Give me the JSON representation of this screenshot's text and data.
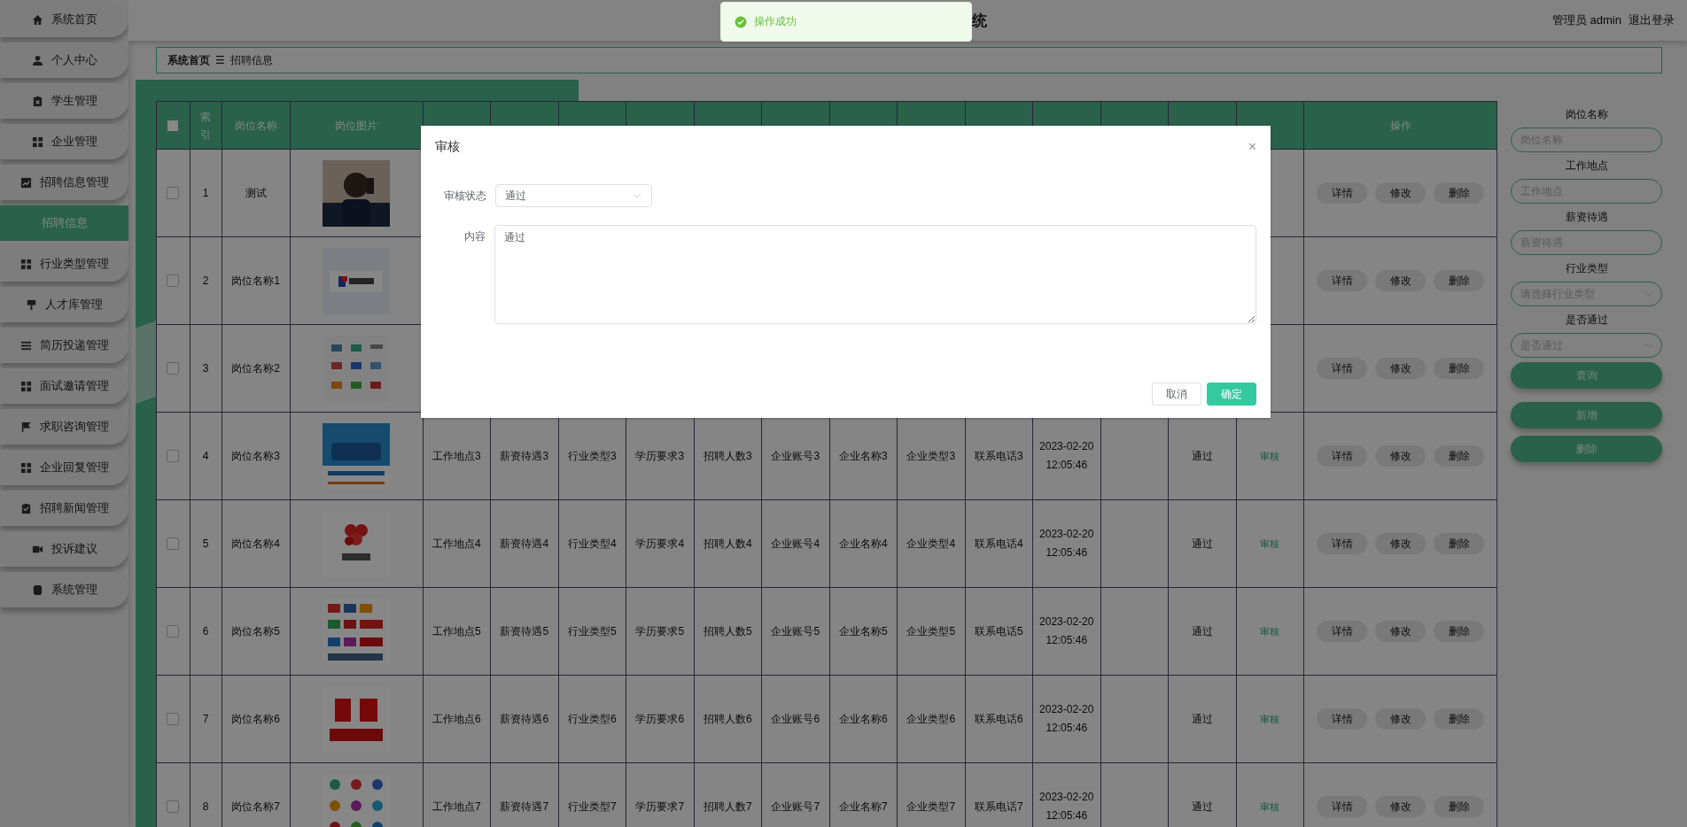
{
  "sidebar": {
    "items": [
      {
        "label": "系统首页",
        "selected": false
      },
      {
        "label": "个人中心",
        "selected": false
      },
      {
        "label": "学生管理",
        "selected": false
      },
      {
        "label": "企业管理",
        "selected": false
      },
      {
        "label": "招聘信息管理",
        "selected": false,
        "children": [
          {
            "label": "招聘信息",
            "selected": true
          }
        ]
      },
      {
        "label": "行业类型管理",
        "selected": false
      },
      {
        "label": "人才库管理",
        "selected": false
      },
      {
        "label": "简历投递管理",
        "selected": false
      },
      {
        "label": "面试邀请管理",
        "selected": false
      },
      {
        "label": "求职咨询管理",
        "selected": false
      },
      {
        "label": "企业回复管理",
        "selected": false
      },
      {
        "label": "招聘新闻管理",
        "selected": false
      },
      {
        "label": "投诉建议",
        "selected": false
      },
      {
        "label": "系统管理",
        "selected": false
      }
    ]
  },
  "header": {
    "title": "统",
    "user": "管理员 admin",
    "logout": "退出登录"
  },
  "breadcrumb": {
    "home": "系统首页",
    "separator": "☰",
    "current": "招聘信息"
  },
  "table": {
    "select_all": {
      "checked": false
    },
    "columns": {
      "index": "索引",
      "name": "岗位名称",
      "image": "岗位图片",
      "actions": "操作"
    },
    "rows": [
      {
        "checked": false,
        "index": "1",
        "name": "测试",
        "actions": [
          "详情",
          "修改",
          "删除"
        ]
      },
      {
        "checked": false,
        "index": "2",
        "name": "岗位名称1",
        "actions": [
          "详情",
          "修改",
          "删除"
        ]
      },
      {
        "checked": false,
        "index": "3",
        "name": "岗位名称2",
        "actions": [
          "详情",
          "修改",
          "删除"
        ]
      },
      {
        "checked": false,
        "index": "4",
        "name": "岗位名称3",
        "location": "工作地点3",
        "salary": "薪资待遇3",
        "industry": "行业类型3",
        "education": "学历要求3",
        "headcount": "招聘人数3",
        "account": "企业账号3",
        "company": "企业名称3",
        "company_type": "企业类型3",
        "phone": "联系电话3",
        "published": "2023-02-20 12:05:46",
        "status": "通过",
        "audit_link": "审核",
        "actions": [
          "详情",
          "修改",
          "删除"
        ]
      },
      {
        "checked": false,
        "index": "5",
        "name": "岗位名称4",
        "location": "工作地点4",
        "salary": "薪资待遇4",
        "industry": "行业类型4",
        "education": "学历要求4",
        "headcount": "招聘人数4",
        "account": "企业账号4",
        "company": "企业名称4",
        "company_type": "企业类型4",
        "phone": "联系电话4",
        "published": "2023-02-20 12:05:46",
        "status": "通过",
        "audit_link": "审核",
        "actions": [
          "详情",
          "修改",
          "删除"
        ]
      },
      {
        "checked": false,
        "index": "6",
        "name": "岗位名称5",
        "location": "工作地点5",
        "salary": "薪资待遇5",
        "industry": "行业类型5",
        "education": "学历要求5",
        "headcount": "招聘人数5",
        "account": "企业账号5",
        "company": "企业名称5",
        "company_type": "企业类型5",
        "phone": "联系电话5",
        "published": "2023-02-20 12:05:46",
        "status": "通过",
        "audit_link": "审核",
        "actions": [
          "详情",
          "修改",
          "删除"
        ]
      },
      {
        "checked": false,
        "index": "7",
        "name": "岗位名称6",
        "location": "工作地点6",
        "salary": "薪资待遇6",
        "industry": "行业类型6",
        "education": "学历要求6",
        "headcount": "招聘人数6",
        "account": "企业账号6",
        "company": "企业名称6",
        "company_type": "企业类型6",
        "phone": "联系电话6",
        "published": "2023-02-20 12:05:46",
        "status": "通过",
        "audit_link": "审核",
        "actions": [
          "详情",
          "修改",
          "删除"
        ]
      },
      {
        "checked": false,
        "index": "8",
        "name": "岗位名称7",
        "location": "工作地点7",
        "salary": "薪资待遇7",
        "industry": "行业类型7",
        "education": "学历要求7",
        "headcount": "招聘人数7",
        "account": "企业账号7",
        "company": "企业名称7",
        "company_type": "企业类型7",
        "phone": "联系电话7",
        "published": "2023-02-20 12:05:46",
        "status": "通过",
        "audit_link": "审核",
        "actions": [
          "详情",
          "修改",
          "删除"
        ]
      }
    ]
  },
  "filters": [
    {
      "kind": "input",
      "label": "岗位名称",
      "placeholder": "岗位名称"
    },
    {
      "kind": "input",
      "label": "工作地点",
      "placeholder": "工作地点"
    },
    {
      "kind": "input",
      "label": "薪资待遇",
      "placeholder": "薪资待遇"
    },
    {
      "kind": "select",
      "label": "行业类型",
      "placeholder": "请选择行业类型"
    },
    {
      "kind": "select",
      "label": "是否通过",
      "placeholder": "是否通过"
    }
  ],
  "filter_buttons": [
    "查询",
    "新增",
    "删除"
  ],
  "dialog": {
    "title": "审核",
    "close": "×",
    "fields": [
      {
        "kind": "select",
        "label": "审核状态",
        "value": "通过"
      },
      {
        "kind": "textarea",
        "label": "内容",
        "value": "通过"
      }
    ],
    "buttons": [
      {
        "kind": "default",
        "label": "取消"
      },
      {
        "kind": "primary",
        "label": "确定"
      }
    ]
  },
  "toast": {
    "kind": "success",
    "message": "操作成功"
  }
}
